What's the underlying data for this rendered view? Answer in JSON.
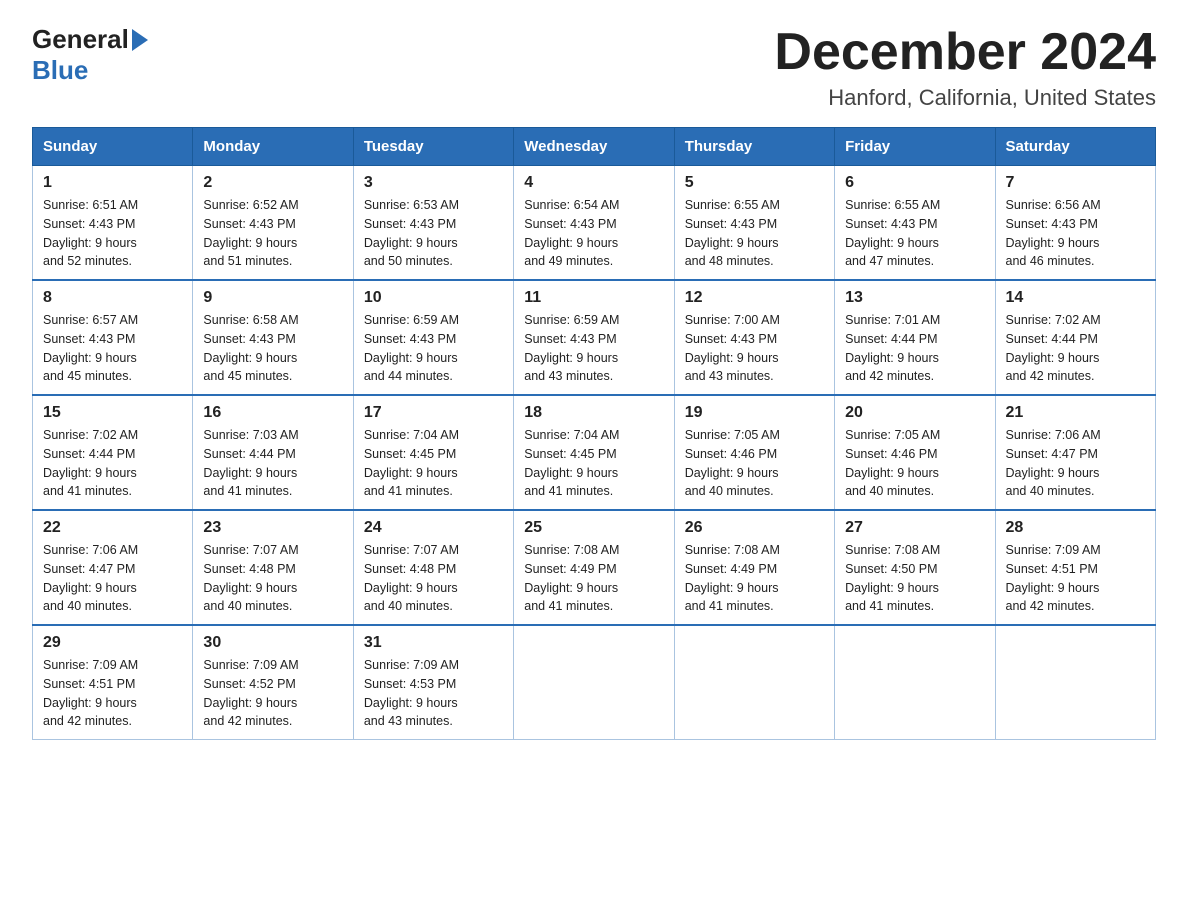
{
  "logo": {
    "line1": "General",
    "line2": "Blue"
  },
  "header": {
    "month": "December 2024",
    "location": "Hanford, California, United States"
  },
  "weekdays": [
    "Sunday",
    "Monday",
    "Tuesday",
    "Wednesday",
    "Thursday",
    "Friday",
    "Saturday"
  ],
  "weeks": [
    [
      {
        "day": "1",
        "sunrise": "6:51 AM",
        "sunset": "4:43 PM",
        "daylight": "9 hours and 52 minutes."
      },
      {
        "day": "2",
        "sunrise": "6:52 AM",
        "sunset": "4:43 PM",
        "daylight": "9 hours and 51 minutes."
      },
      {
        "day": "3",
        "sunrise": "6:53 AM",
        "sunset": "4:43 PM",
        "daylight": "9 hours and 50 minutes."
      },
      {
        "day": "4",
        "sunrise": "6:54 AM",
        "sunset": "4:43 PM",
        "daylight": "9 hours and 49 minutes."
      },
      {
        "day": "5",
        "sunrise": "6:55 AM",
        "sunset": "4:43 PM",
        "daylight": "9 hours and 48 minutes."
      },
      {
        "day": "6",
        "sunrise": "6:55 AM",
        "sunset": "4:43 PM",
        "daylight": "9 hours and 47 minutes."
      },
      {
        "day": "7",
        "sunrise": "6:56 AM",
        "sunset": "4:43 PM",
        "daylight": "9 hours and 46 minutes."
      }
    ],
    [
      {
        "day": "8",
        "sunrise": "6:57 AM",
        "sunset": "4:43 PM",
        "daylight": "9 hours and 45 minutes."
      },
      {
        "day": "9",
        "sunrise": "6:58 AM",
        "sunset": "4:43 PM",
        "daylight": "9 hours and 45 minutes."
      },
      {
        "day": "10",
        "sunrise": "6:59 AM",
        "sunset": "4:43 PM",
        "daylight": "9 hours and 44 minutes."
      },
      {
        "day": "11",
        "sunrise": "6:59 AM",
        "sunset": "4:43 PM",
        "daylight": "9 hours and 43 minutes."
      },
      {
        "day": "12",
        "sunrise": "7:00 AM",
        "sunset": "4:43 PM",
        "daylight": "9 hours and 43 minutes."
      },
      {
        "day": "13",
        "sunrise": "7:01 AM",
        "sunset": "4:44 PM",
        "daylight": "9 hours and 42 minutes."
      },
      {
        "day": "14",
        "sunrise": "7:02 AM",
        "sunset": "4:44 PM",
        "daylight": "9 hours and 42 minutes."
      }
    ],
    [
      {
        "day": "15",
        "sunrise": "7:02 AM",
        "sunset": "4:44 PM",
        "daylight": "9 hours and 41 minutes."
      },
      {
        "day": "16",
        "sunrise": "7:03 AM",
        "sunset": "4:44 PM",
        "daylight": "9 hours and 41 minutes."
      },
      {
        "day": "17",
        "sunrise": "7:04 AM",
        "sunset": "4:45 PM",
        "daylight": "9 hours and 41 minutes."
      },
      {
        "day": "18",
        "sunrise": "7:04 AM",
        "sunset": "4:45 PM",
        "daylight": "9 hours and 41 minutes."
      },
      {
        "day": "19",
        "sunrise": "7:05 AM",
        "sunset": "4:46 PM",
        "daylight": "9 hours and 40 minutes."
      },
      {
        "day": "20",
        "sunrise": "7:05 AM",
        "sunset": "4:46 PM",
        "daylight": "9 hours and 40 minutes."
      },
      {
        "day": "21",
        "sunrise": "7:06 AM",
        "sunset": "4:47 PM",
        "daylight": "9 hours and 40 minutes."
      }
    ],
    [
      {
        "day": "22",
        "sunrise": "7:06 AM",
        "sunset": "4:47 PM",
        "daylight": "9 hours and 40 minutes."
      },
      {
        "day": "23",
        "sunrise": "7:07 AM",
        "sunset": "4:48 PM",
        "daylight": "9 hours and 40 minutes."
      },
      {
        "day": "24",
        "sunrise": "7:07 AM",
        "sunset": "4:48 PM",
        "daylight": "9 hours and 40 minutes."
      },
      {
        "day": "25",
        "sunrise": "7:08 AM",
        "sunset": "4:49 PM",
        "daylight": "9 hours and 41 minutes."
      },
      {
        "day": "26",
        "sunrise": "7:08 AM",
        "sunset": "4:49 PM",
        "daylight": "9 hours and 41 minutes."
      },
      {
        "day": "27",
        "sunrise": "7:08 AM",
        "sunset": "4:50 PM",
        "daylight": "9 hours and 41 minutes."
      },
      {
        "day": "28",
        "sunrise": "7:09 AM",
        "sunset": "4:51 PM",
        "daylight": "9 hours and 42 minutes."
      }
    ],
    [
      {
        "day": "29",
        "sunrise": "7:09 AM",
        "sunset": "4:51 PM",
        "daylight": "9 hours and 42 minutes."
      },
      {
        "day": "30",
        "sunrise": "7:09 AM",
        "sunset": "4:52 PM",
        "daylight": "9 hours and 42 minutes."
      },
      {
        "day": "31",
        "sunrise": "7:09 AM",
        "sunset": "4:53 PM",
        "daylight": "9 hours and 43 minutes."
      },
      null,
      null,
      null,
      null
    ]
  ],
  "labels": {
    "sunrise": "Sunrise:",
    "sunset": "Sunset:",
    "daylight": "Daylight:"
  }
}
